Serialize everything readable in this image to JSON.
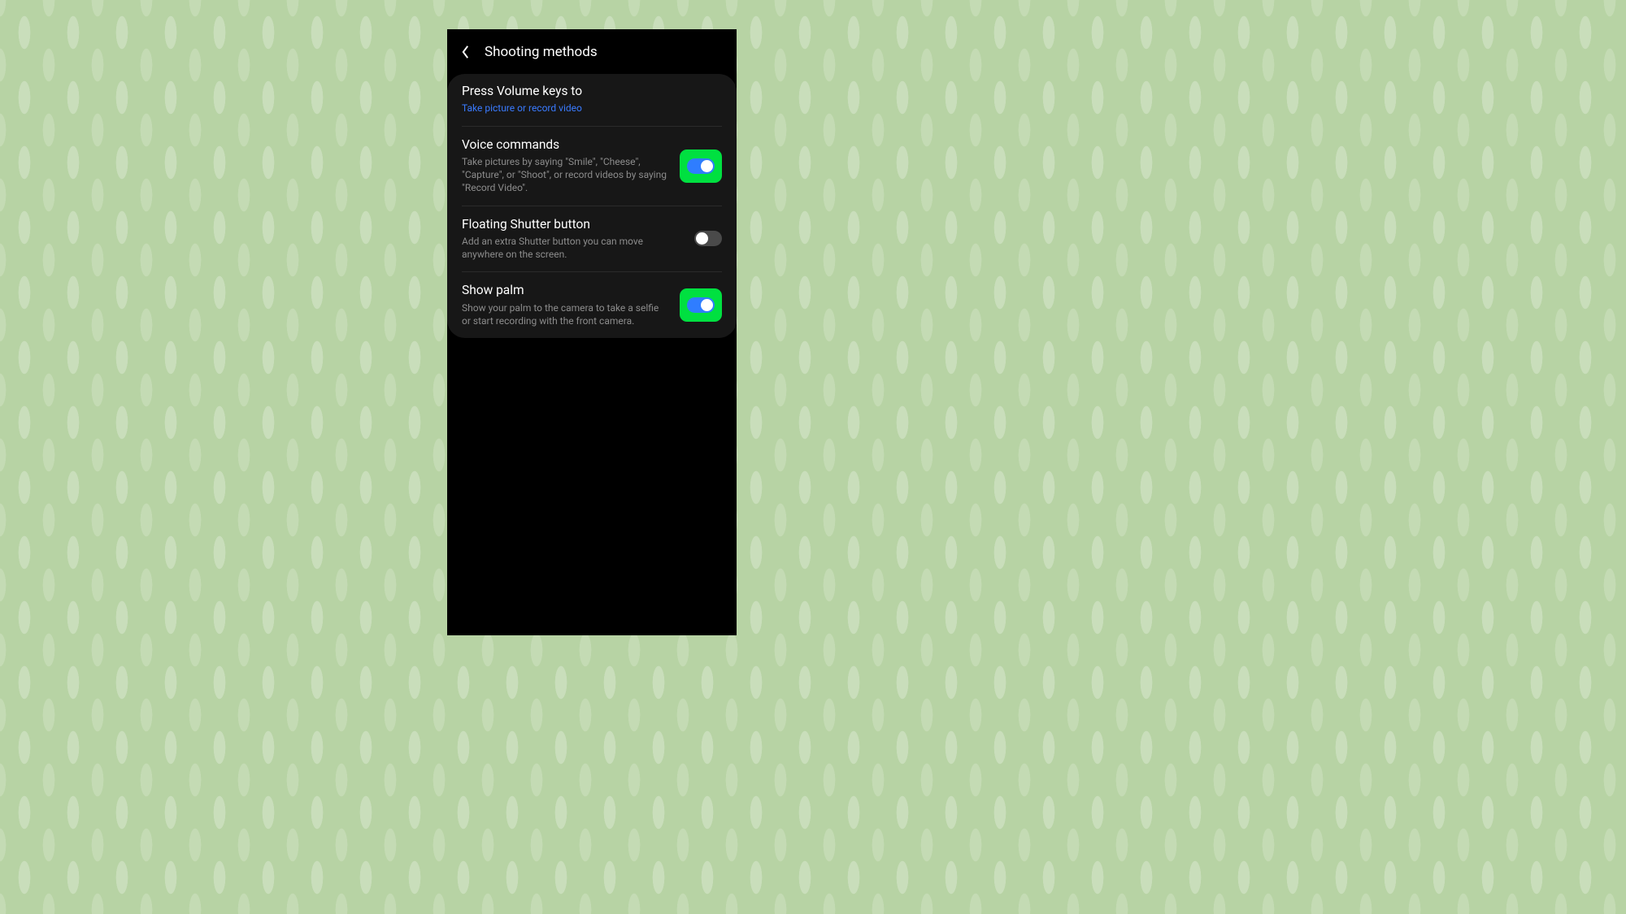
{
  "header": {
    "title": "Shooting methods"
  },
  "accent_blue": "#3a7bff",
  "highlight_green": "#00e040",
  "settings": [
    {
      "label": "Press Volume keys to",
      "sub": "Take picture or record video",
      "sub_style": "link",
      "control": "none"
    },
    {
      "label": "Voice commands",
      "sub": "Take pictures by saying \"Smile\", \"Cheese\", \"Capture\", or \"Shoot\", or record videos by saying \"Record Video\".",
      "sub_style": "muted",
      "control": "toggle",
      "toggle_on": true,
      "highlighted": true
    },
    {
      "label": "Floating Shutter button",
      "sub": "Add an extra Shutter button you can move anywhere on the screen.",
      "sub_style": "muted",
      "control": "toggle",
      "toggle_on": false,
      "highlighted": false
    },
    {
      "label": "Show palm",
      "sub": "Show your palm to the camera to take a selfie or start recording with the front camera.",
      "sub_style": "muted",
      "control": "toggle",
      "toggle_on": true,
      "highlighted": true
    }
  ]
}
